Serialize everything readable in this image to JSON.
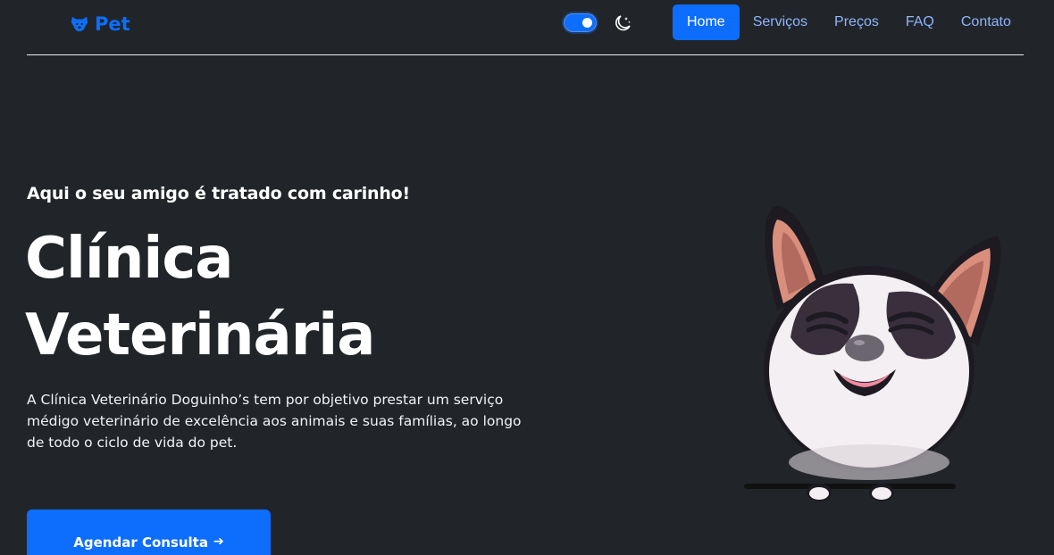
{
  "navbar": {
    "brand": "Pet",
    "links": [
      {
        "label": "Home",
        "active": true
      },
      {
        "label": "Serviços",
        "active": false
      },
      {
        "label": "Preços",
        "active": false
      },
      {
        "label": "FAQ",
        "active": false
      },
      {
        "label": "Contato",
        "active": false
      }
    ],
    "theme_switch_on": true
  },
  "hero": {
    "tagline": "Aqui o seu amigo é tratado com carinho!",
    "title_line1": "Clínica",
    "title_line2": "Veterinária",
    "description": "A Clínica Veterinário Doguinho’s tem por objetivo prestar um serviço médigo veterinário de excelência aos animais e suas famílias, ao longo de todo o ciclo de vida do pet.",
    "cta_label": "Agendar Consulta"
  },
  "icons": {
    "brand": "dog-face-icon",
    "theme": "moon-stars-icon",
    "cta": "arrow-right-icon"
  },
  "colors": {
    "background": "#212529",
    "accent": "#0d6efd",
    "nav_link": "#8fb4ff"
  }
}
